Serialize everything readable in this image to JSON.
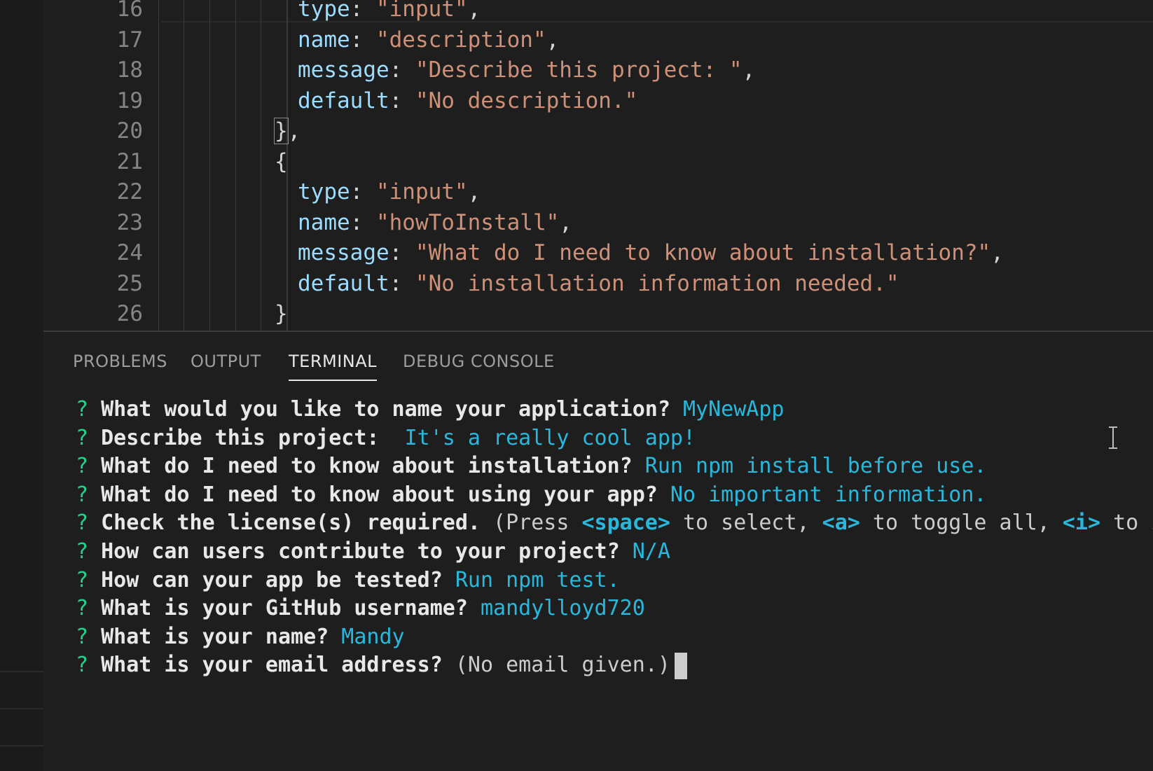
{
  "editor": {
    "lines": [
      {
        "num": "16",
        "indent": 1,
        "tokens": [
          {
            "t": "type",
            "c": "key"
          },
          {
            "t": ": ",
            "c": "punc"
          },
          {
            "t": "\"input\"",
            "c": "str"
          },
          {
            "t": ",",
            "c": "punc"
          }
        ]
      },
      {
        "num": "17",
        "indent": 1,
        "tokens": [
          {
            "t": "name",
            "c": "key"
          },
          {
            "t": ": ",
            "c": "punc"
          },
          {
            "t": "\"description\"",
            "c": "str"
          },
          {
            "t": ",",
            "c": "punc"
          }
        ]
      },
      {
        "num": "18",
        "indent": 1,
        "tokens": [
          {
            "t": "message",
            "c": "key"
          },
          {
            "t": ": ",
            "c": "punc"
          },
          {
            "t": "\"Describe this project: \"",
            "c": "str"
          },
          {
            "t": ",",
            "c": "punc"
          }
        ]
      },
      {
        "num": "19",
        "indent": 1,
        "tokens": [
          {
            "t": "default",
            "c": "key"
          },
          {
            "t": ": ",
            "c": "punc"
          },
          {
            "t": "\"No description.\"",
            "c": "str"
          }
        ]
      },
      {
        "num": "20",
        "indent": 0,
        "tokens": [
          {
            "t": "}",
            "c": "punc",
            "box": true
          },
          {
            "t": ",",
            "c": "punc"
          }
        ]
      },
      {
        "num": "21",
        "indent": 0,
        "tokens": [
          {
            "t": "{",
            "c": "punc"
          }
        ]
      },
      {
        "num": "22",
        "indent": 1,
        "tokens": [
          {
            "t": "type",
            "c": "key"
          },
          {
            "t": ": ",
            "c": "punc"
          },
          {
            "t": "\"input\"",
            "c": "str"
          },
          {
            "t": ",",
            "c": "punc"
          }
        ]
      },
      {
        "num": "23",
        "indent": 1,
        "tokens": [
          {
            "t": "name",
            "c": "key"
          },
          {
            "t": ": ",
            "c": "punc"
          },
          {
            "t": "\"howToInstall\"",
            "c": "str"
          },
          {
            "t": ",",
            "c": "punc"
          }
        ]
      },
      {
        "num": "24",
        "indent": 1,
        "tokens": [
          {
            "t": "message",
            "c": "key"
          },
          {
            "t": ": ",
            "c": "punc"
          },
          {
            "t": "\"What do I need to know about installation?\"",
            "c": "str"
          },
          {
            "t": ",",
            "c": "punc"
          }
        ]
      },
      {
        "num": "25",
        "indent": 1,
        "tokens": [
          {
            "t": "default",
            "c": "key"
          },
          {
            "t": ": ",
            "c": "punc"
          },
          {
            "t": "\"No installation information needed.\"",
            "c": "str"
          }
        ]
      },
      {
        "num": "26",
        "indent": 0,
        "tokens": [
          {
            "t": "}",
            "c": "punc"
          }
        ]
      }
    ]
  },
  "panel": {
    "tabs": [
      {
        "label": "PROBLEMS",
        "active": false
      },
      {
        "label": "OUTPUT",
        "active": false
      },
      {
        "label": "TERMINAL",
        "active": true
      },
      {
        "label": "DEBUG CONSOLE",
        "active": false
      }
    ]
  },
  "terminal": {
    "lines": [
      {
        "q": "?",
        "prompt": "What would you like to name your application?",
        "answer": "MyNewApp"
      },
      {
        "q": "?",
        "prompt": "Describe this project: ",
        "answer": "It's a really cool app!"
      },
      {
        "q": "?",
        "prompt": "What do I need to know about installation?",
        "answer": "Run npm install before use."
      },
      {
        "q": "?",
        "prompt": "What do I need to know about using your app?",
        "answer": "No important information."
      },
      {
        "q": "?",
        "prompt": "Check the license(s) required.",
        "hint_parts": [
          {
            "t": "(Press ",
            "c": "hint"
          },
          {
            "t": "<space>",
            "c": "key"
          },
          {
            "t": " to select, ",
            "c": "hint"
          },
          {
            "t": "<a>",
            "c": "key"
          },
          {
            "t": " to toggle all, ",
            "c": "hint"
          },
          {
            "t": "<i>",
            "c": "key"
          },
          {
            "t": " to i",
            "c": "hint"
          }
        ]
      },
      {
        "q": "?",
        "prompt": "How can users contribute to your project?",
        "answer": "N/A"
      },
      {
        "q": "?",
        "prompt": "How can your app be tested?",
        "answer": "Run npm test."
      },
      {
        "q": "?",
        "prompt": "What is your GitHub username?",
        "answer": "mandylloyd720"
      },
      {
        "q": "?",
        "prompt": "What is your name?",
        "answer": "Mandy"
      },
      {
        "q": "?",
        "prompt": "What is your email address?",
        "hint": "(No email given.)",
        "cursor": true
      }
    ]
  },
  "colors": {
    "background": "#1e1e1e",
    "key": "#9cdcfe",
    "string": "#ce9178",
    "question_mark": "#23d18b",
    "answer": "#29b8db"
  }
}
